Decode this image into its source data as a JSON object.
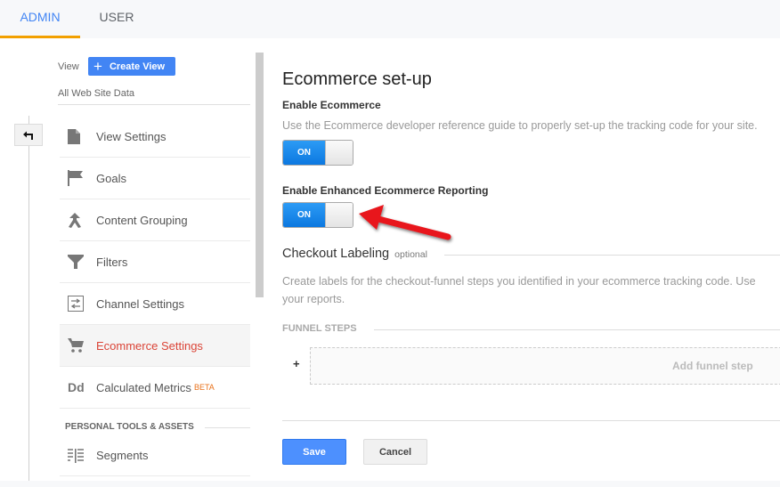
{
  "tabs": [
    {
      "label": "ADMIN",
      "active": true
    },
    {
      "label": "USER",
      "active": false
    }
  ],
  "sidebar": {
    "view_label": "View",
    "create_view_label": "Create View",
    "view_name": "All Web Site Data",
    "back_icon": "back-arrow-icon",
    "items": [
      {
        "label": "View Settings",
        "icon": "document-icon",
        "active": false
      },
      {
        "label": "Goals",
        "icon": "flag-icon",
        "active": false
      },
      {
        "label": "Content Grouping",
        "icon": "merge-icon",
        "active": false
      },
      {
        "label": "Filters",
        "icon": "filter-icon",
        "active": false
      },
      {
        "label": "Channel Settings",
        "icon": "channel-icon",
        "active": false
      },
      {
        "label": "Ecommerce Settings",
        "icon": "cart-icon",
        "active": true
      },
      {
        "label": "Calculated Metrics",
        "badge": "BETA",
        "icon": "dd-icon",
        "active": false
      }
    ],
    "section_heading": "PERSONAL TOOLS & ASSETS",
    "section_items": [
      {
        "label": "Segments",
        "icon": "segments-icon"
      }
    ]
  },
  "main": {
    "title": "Ecommerce set-up",
    "enable_ecommerce": {
      "label": "Enable Ecommerce",
      "description": "Use the Ecommerce developer reference guide to properly set-up the tracking code for your site.",
      "toggle": "ON"
    },
    "enable_enhanced": {
      "label": "Enable Enhanced Ecommerce Reporting",
      "toggle": "ON"
    },
    "checkout": {
      "title": "Checkout Labeling",
      "optional": "optional",
      "description_line1": "Create labels for the checkout-funnel steps you identified in your ecommerce tracking code. Use",
      "description_line2": "your reports."
    },
    "funnel": {
      "heading": "FUNNEL STEPS",
      "plus": "+",
      "add_label": "Add funnel step"
    },
    "save_label": "Save",
    "cancel_label": "Cancel"
  },
  "colors": {
    "accent_blue": "#4285f4",
    "active_tab_underline": "#f2a000",
    "active_nav_text": "#db4437",
    "annotation_arrow": "#e8141a"
  }
}
